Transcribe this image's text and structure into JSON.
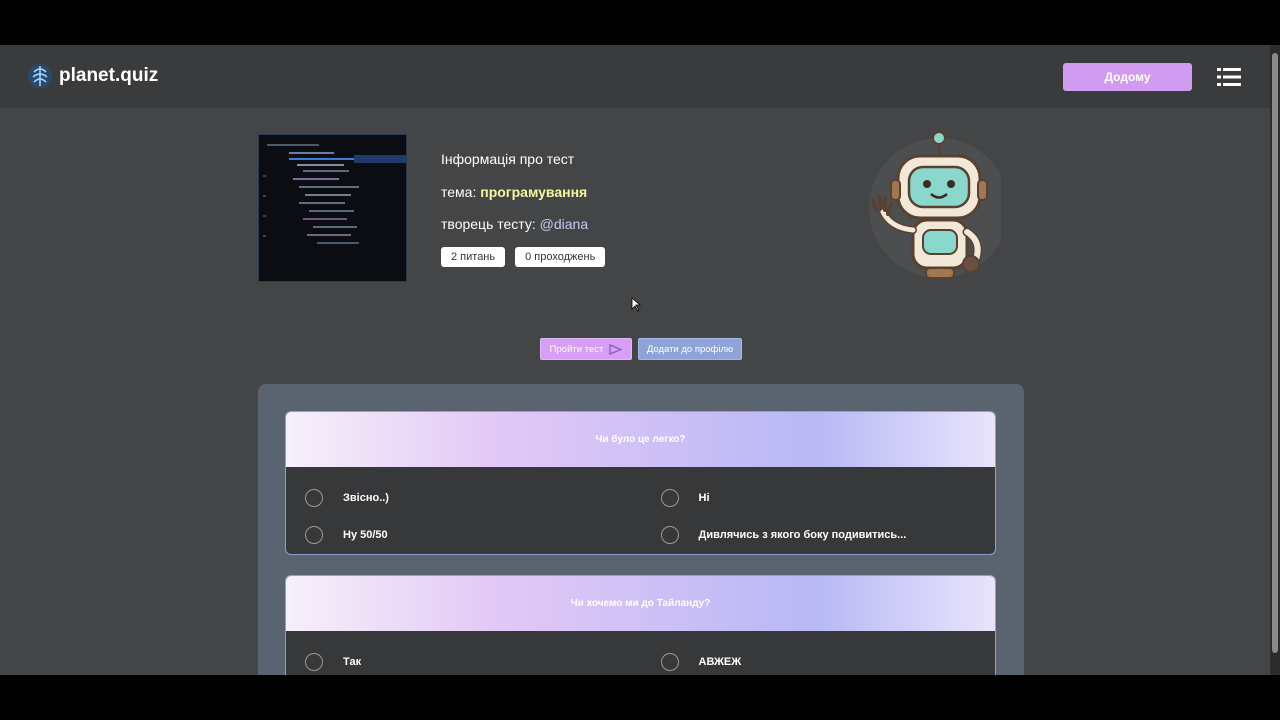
{
  "header": {
    "logo_text": "planet.quiz",
    "home_label": "Додому"
  },
  "quiz_info": {
    "heading": "Інформація про тест",
    "topic_prefix": "тема: ",
    "topic": "програмування",
    "creator_prefix": "творець тесту: ",
    "creator": "@diana",
    "questions_count": "2 питань",
    "attempts_count": "0 проходжень"
  },
  "actions": {
    "take_label": "Пройти тест",
    "add_label": "Додати до профілю"
  },
  "questions": [
    {
      "title": "Чи було це легко?",
      "options": [
        "Звісно..)",
        "Ні",
        "Ну 50/50",
        "Дивлячись з якого боку подивитись..."
      ]
    },
    {
      "title": "Чи хочемо ми до Тайланду?",
      "options": [
        "Так",
        "АВЖЕЖ"
      ]
    }
  ],
  "colors": {
    "accent_purple": "#d19cf0",
    "accent_blue": "#8fa3d8",
    "background": "#444546",
    "header": "#3a3b3d"
  }
}
